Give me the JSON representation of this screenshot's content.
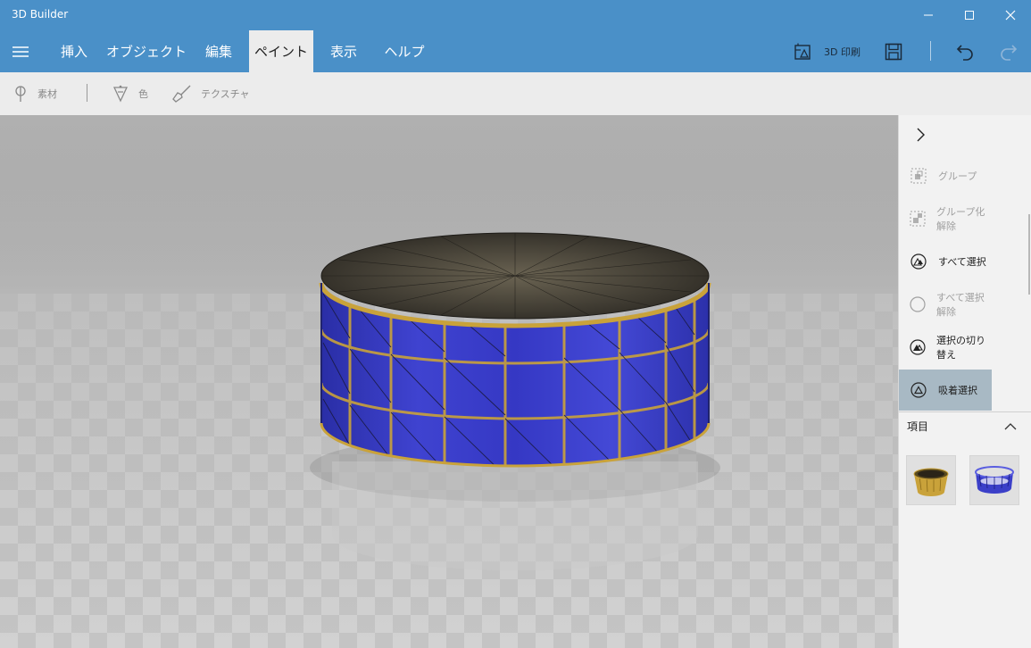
{
  "window": {
    "title": "3D Builder",
    "accent": "#4a90c8"
  },
  "menu": {
    "tabs": [
      {
        "label": "挿入"
      },
      {
        "label": "オブジェクト"
      },
      {
        "label": "編集"
      },
      {
        "label": "ペイント",
        "active": true
      },
      {
        "label": "表示"
      },
      {
        "label": "ヘルプ"
      }
    ],
    "print_label": "3D 印刷"
  },
  "toolbar": {
    "material_label": "素材",
    "color_label": "色",
    "texture_label": "テクスチャ"
  },
  "panel": {
    "items": [
      {
        "label": "グループ",
        "state": "disabled"
      },
      {
        "label": "グループ化解除",
        "state": "disabled"
      },
      {
        "label": "すべて選択",
        "state": "enabled"
      },
      {
        "label": "すべて選択解除",
        "state": "disabled"
      },
      {
        "label": "選択の切り替え",
        "state": "enabled"
      },
      {
        "label": "吸着選択",
        "state": "highlight"
      }
    ],
    "items_header": "項目"
  },
  "colors": {
    "model_blue": "#3b3fc8",
    "model_gold": "#c9a23a",
    "model_top": "#3a352d",
    "highlight": "#a8b9c4"
  }
}
